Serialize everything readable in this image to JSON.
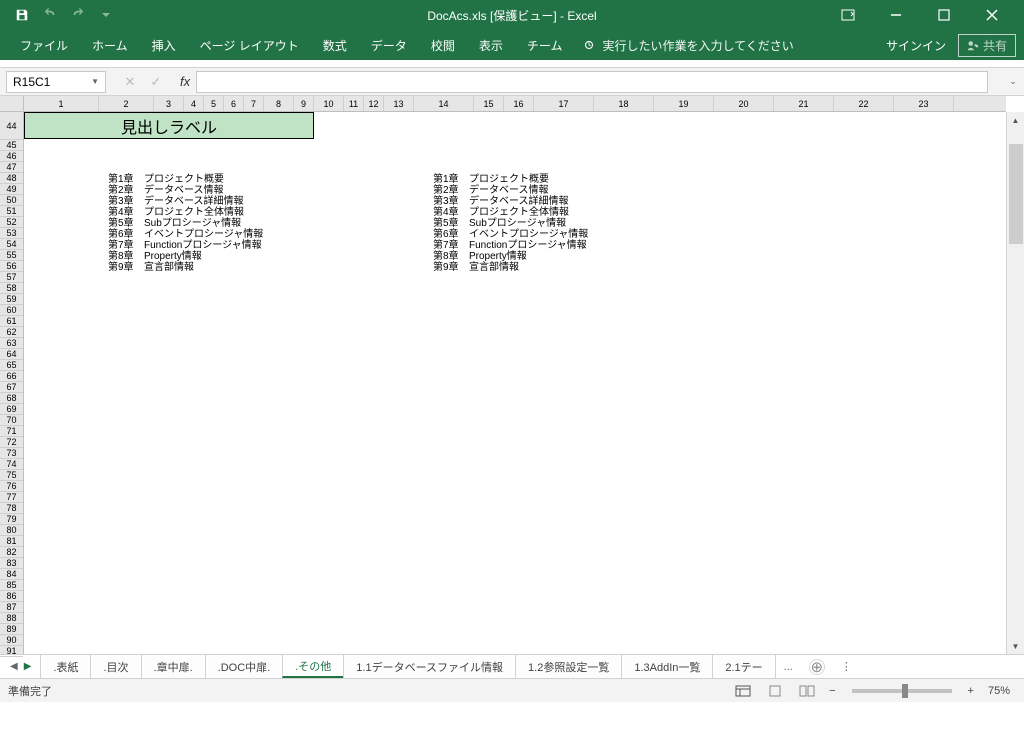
{
  "title": "DocAcs.xls [保護ビュー] - Excel",
  "qat": {
    "save": "save",
    "undo": "undo",
    "redo": "redo"
  },
  "ribbon": {
    "tabs": [
      "ファイル",
      "ホーム",
      "挿入",
      "ページ レイアウト",
      "数式",
      "データ",
      "校閲",
      "表示",
      "チーム"
    ],
    "tellme_placeholder": "実行したい作業を入力してください",
    "signin": "サインイン",
    "share": "共有"
  },
  "namebox": "R15C1",
  "sheet": {
    "header_label": "見出しラベル",
    "rows_start": 44,
    "rows_end": 91,
    "cols": [
      "1",
      "2",
      "3",
      "4",
      "5",
      "6",
      "7",
      "8",
      "9",
      "10",
      "11",
      "12",
      "13",
      "14",
      "15",
      "16",
      "17",
      "18",
      "19",
      "20",
      "21",
      "22",
      "23"
    ],
    "block1": [
      {
        "ch": "第1章",
        "t": "プロジェクト概要"
      },
      {
        "ch": "第2章",
        "t": "データベース情報"
      },
      {
        "ch": "第3章",
        "t": "データベース詳細情報"
      },
      {
        "ch": "第4章",
        "t": "プロジェクト全体情報"
      },
      {
        "ch": "第5章",
        "t": "Subプロシージャ情報"
      },
      {
        "ch": "第6章",
        "t": "イベントプロシージャ情報"
      },
      {
        "ch": "第7章",
        "t": "Functionプロシージャ情報"
      },
      {
        "ch": "第8章",
        "t": "Property情報"
      },
      {
        "ch": "第9章",
        "t": "宣言部情報"
      }
    ],
    "block2": [
      {
        "ch": "第1章",
        "t": "プロジェクト概要"
      },
      {
        "ch": "第2章",
        "t": "データベース情報"
      },
      {
        "ch": "第3章",
        "t": "データベース詳細情報"
      },
      {
        "ch": "第4章",
        "t": "プロジェクト全体情報"
      },
      {
        "ch": "第5章",
        "t": "Subプロシージャ情報"
      },
      {
        "ch": "第6章",
        "t": "イベントプロシージャ情報"
      },
      {
        "ch": "第7章",
        "t": "Functionプロシージャ情報"
      },
      {
        "ch": "第8章",
        "t": "Property情報"
      },
      {
        "ch": "第9章",
        "t": "宣言部情報"
      }
    ]
  },
  "sheettabs": {
    "tabs": [
      ".表紙",
      ".目次",
      ".章中扉.",
      ".DOC中扉.",
      ".その他",
      "1.1データベースファイル情報",
      "1.2参照設定一覧",
      "1.3AddIn一覧",
      "2.1テー"
    ],
    "active_index": 4,
    "more": "..."
  },
  "status": {
    "ready": "準備完了",
    "zoom": "75%"
  }
}
